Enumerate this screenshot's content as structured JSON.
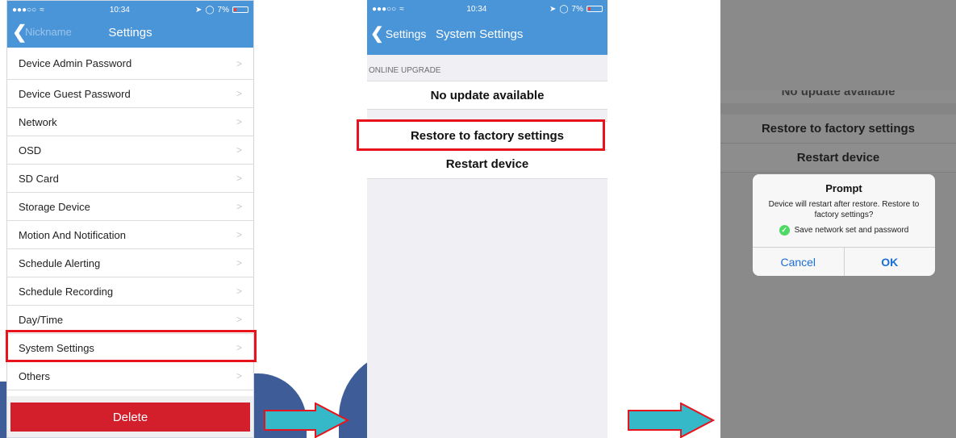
{
  "colors": {
    "accent": "#4a94d8",
    "highlight": "#e8141d",
    "delete": "#d21f2b",
    "arrow_fill": "#35b8c8",
    "watermark": "#2e4f8f"
  },
  "status_bar": {
    "signal": "●●●○○",
    "wifi": "wifi-icon",
    "time": "10:34",
    "right": "7%"
  },
  "screen1": {
    "nav_ghost": "Nickname",
    "title": "Settings",
    "items": [
      {
        "label": "Device Admin Password"
      },
      {
        "label": "Device Guest Password"
      },
      {
        "label": "Network"
      },
      {
        "label": "OSD"
      },
      {
        "label": "SD Card"
      },
      {
        "label": "Storage Device"
      },
      {
        "label": "Motion And Notification"
      },
      {
        "label": "Schedule Alerting"
      },
      {
        "label": "Schedule Recording"
      },
      {
        "label": "Day/Time"
      },
      {
        "label": "System Settings"
      },
      {
        "label": "Others"
      }
    ],
    "chevron": ">",
    "delete_label": "Delete"
  },
  "screen2": {
    "back_label": "Settings",
    "title": "System Settings",
    "section": "ONLINE UPGRADE",
    "update": "No update available",
    "restore": "Restore to factory settings",
    "restart": "Restart device"
  },
  "screen3": {
    "cut_text": "No update available",
    "restore": "Restore to factory settings",
    "restart": "Restart device",
    "dialog": {
      "title": "Prompt",
      "message": "Device will restart after restore. Restore to factory settings?",
      "check_label": "Save network set and password",
      "cancel": "Cancel",
      "ok": "OK"
    }
  }
}
